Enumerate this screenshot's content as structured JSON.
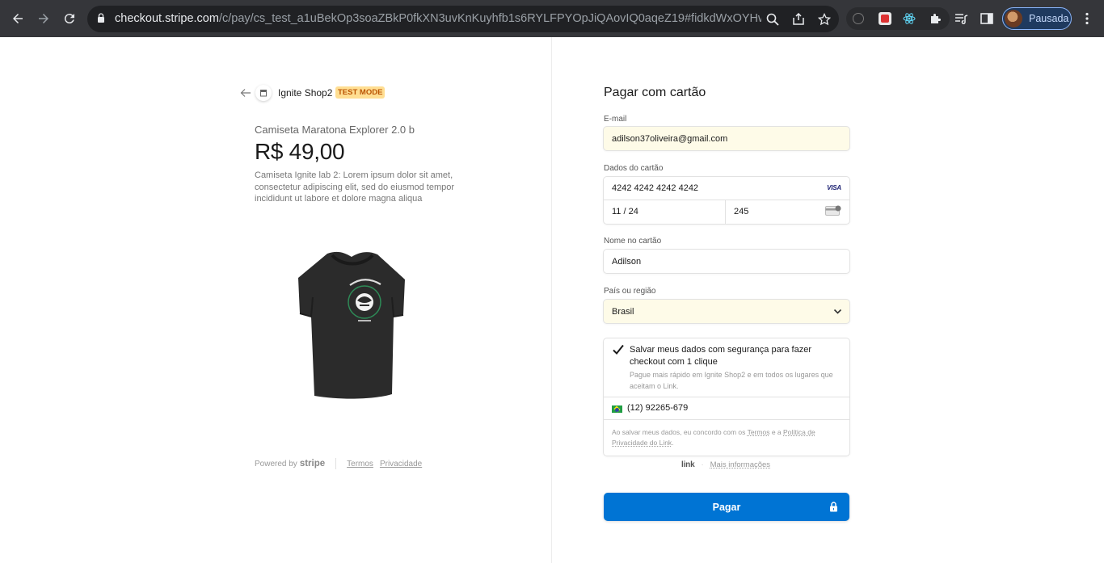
{
  "browser": {
    "url_host": "checkout.stripe.com",
    "url_path": "/c/pay/cs_test_a1uBekOp3soaZBkP0fkXN3uvKnKuyhfb1s6RYLFPYOpJiQAovIQ0aqeZ19#fidkdWxOYHwnPyd...",
    "profile_label": "Pausada",
    "icons": [
      "back-icon",
      "forward-icon",
      "reload-icon",
      "lock-icon",
      "zoom-icon",
      "share-icon",
      "star-icon",
      "extension-icon",
      "react-icon",
      "puzzle-icon",
      "media-icon",
      "sidepanel-icon",
      "menu-icon"
    ]
  },
  "merchant": {
    "name": "Ignite Shop2",
    "badge": "TEST MODE"
  },
  "product": {
    "name": "Camiseta Maratona Explorer 2.0 b",
    "price": "R$ 49,00",
    "description": "Camiseta Ignite lab 2: Lorem ipsum dolor sit amet, consectetur adipiscing elit, sed do eiusmod tempor incididunt ut labore et dolore magna aliqua"
  },
  "footer_left": {
    "powered_by": "Powered by",
    "brand": "stripe",
    "terms": "Termos",
    "privacy": "Privacidade"
  },
  "form": {
    "title": "Pagar com cartão",
    "email_label": "E-mail",
    "email_value": "adilson37oliveira@gmail.com",
    "card_label": "Dados do cartão",
    "card_number": "4242 4242 4242 4242",
    "card_brand": "VISA",
    "card_expiry": "11 / 24",
    "card_cvc": "245",
    "name_label": "Nome no cartão",
    "name_value": "Adilson",
    "country_label": "País ou região",
    "country_value": "Brasil"
  },
  "link": {
    "save_title": "Salvar meus dados com segurança para fazer checkout com 1 clique",
    "save_subtitle": "Pague mais rápido em Ignite Shop2 e em todos os lugares que aceitam o Link.",
    "phone": "(12) 92265-679",
    "consent_prefix": "Ao salvar meus dados, eu concordo com os ",
    "consent_terms": "Termos",
    "consent_mid": " e a ",
    "consent_privacy": "Política de Privacidade do Link",
    "consent_suffix": ".",
    "brand": "link",
    "more_info": "Mais informações"
  },
  "pay_button": "Pagar",
  "colors": {
    "accent": "#0074d4",
    "badge_bg": "#ffde92",
    "badge_fg": "#bb5504",
    "filled_bg": "#fefbe8"
  }
}
